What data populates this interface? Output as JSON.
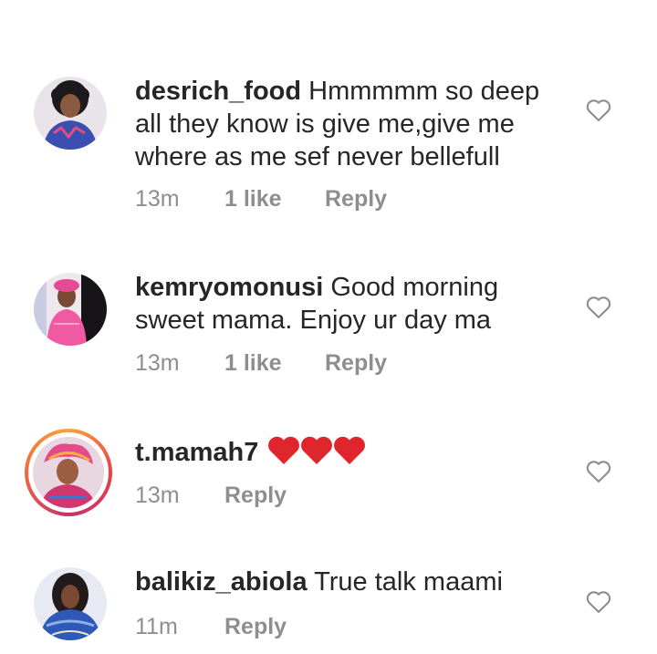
{
  "comments": [
    {
      "username": "desrich_food",
      "text": "Hmmmmm so deep all they know is give me,give me where as me sef never bellefull",
      "time": "13m",
      "likes": "1 like",
      "reply": "Reply",
      "avatar": "woman-blue-dress"
    },
    {
      "username": "kemryomonusi",
      "text": "Good morning sweet mama. Enjoy ur day ma",
      "time": "13m",
      "likes": "1 like",
      "reply": "Reply",
      "avatar": "woman-pink-dress"
    },
    {
      "username": "t.mamah7",
      "text": "",
      "emoji": "red-heart x3",
      "time": "13m",
      "reply": "Reply",
      "avatar": "woman-gele-story-ring"
    },
    {
      "username": "balikiz_abiola",
      "text": "True talk maami",
      "time": "11m",
      "reply": "Reply",
      "avatar": "woman-blue-scarf"
    }
  ],
  "icons": {
    "like": "heart-outline-icon",
    "emoji": "red-heart-icon"
  },
  "colors": {
    "text": "#262626",
    "meta": "#8e8e8e",
    "heart_emoji": "#e0262d"
  }
}
